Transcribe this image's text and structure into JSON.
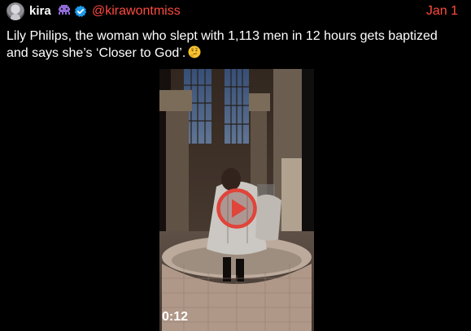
{
  "post": {
    "author": {
      "display_name": "kira",
      "handle": "@kirawontmiss",
      "badge_emoji": "alien-monster-icon",
      "verified": true
    },
    "date": "Jan 1",
    "text": "Lily Philips, the woman who slept with 1,113 men in 12 hours gets baptized and says she’s ‘Closer to God’.",
    "text_emoji": "thinking-face-icon",
    "video": {
      "duration": "0:12",
      "play_icon": "play-icon"
    }
  },
  "colors": {
    "background": "#000000",
    "accent": "#ff4a3d",
    "verified": "#1d9bf0",
    "play_ring": "#e0443a"
  }
}
